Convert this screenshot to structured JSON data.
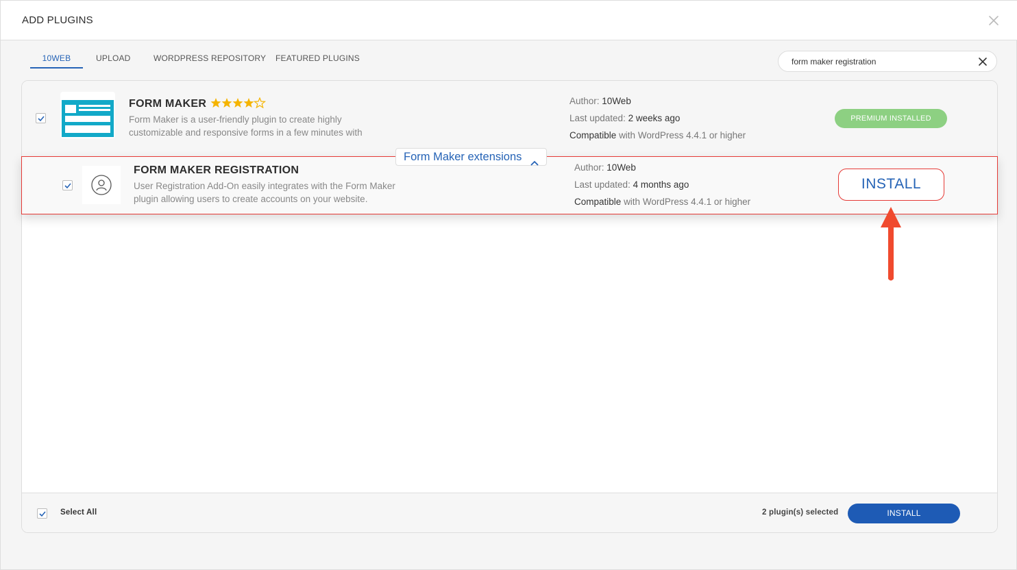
{
  "header": {
    "title": "ADD PLUGINS",
    "close_icon": "close-icon"
  },
  "tabs": [
    {
      "label": "10WEB",
      "active": true
    },
    {
      "label": "UPLOAD",
      "active": false
    },
    {
      "label": "WORDPRESS REPOSITORY",
      "active": false
    },
    {
      "label": "FEATURED PLUGINS",
      "active": false
    }
  ],
  "search": {
    "value": "form maker registration",
    "clear_icon": "close-icon"
  },
  "plugins": [
    {
      "name": "FORM MAKER",
      "rating": 4.5,
      "description_line1": "Form Maker is a user-friendly plugin to create highly",
      "description_line2": "customizable and responsive forms in a few minutes with",
      "author_label": "Author:",
      "author": "10Web",
      "updated_label": "Last updated:",
      "updated": "2 weeks ago",
      "compat_label": "Compatible",
      "compat_text": "with WordPress 4.4.1 or higher",
      "action_label": "PREMIUM INSTALLED",
      "checked": true,
      "icon": "form-maker-logo"
    },
    {
      "name": "FORM MAKER REGISTRATION",
      "description_line1": "User Registration Add-On easily integrates with the Form Maker",
      "description_line2": "plugin allowing users to create accounts on your website.",
      "author_label": "Author:",
      "author": "10Web",
      "updated_label": "Last updated:",
      "updated": "4 months ago",
      "compat_label": "Compatible",
      "compat_text": "with WordPress 4.4.1 or higher",
      "action_label": "INSTALL",
      "checked": true,
      "icon": "user-icon"
    }
  ],
  "extensions_toggle": {
    "label": "Form Maker extensions",
    "icon": "chevron-up-icon"
  },
  "footer": {
    "select_all_label": "Select All",
    "selected_count": "2 plugin(s) selected",
    "install_label": "INSTALL"
  },
  "colors": {
    "accent": "#2563b6",
    "premium": "#8dd082",
    "highlight": "#e53935",
    "install_button": "#1e5bb5"
  }
}
